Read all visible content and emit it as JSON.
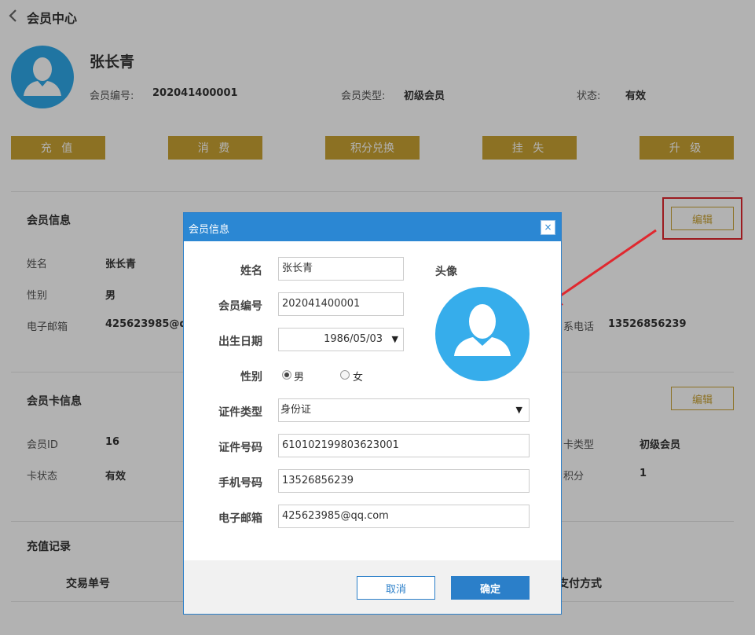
{
  "header": {
    "title": "会员中心"
  },
  "member": {
    "name": "张长青",
    "number_label": "会员编号:",
    "number": "202041400001",
    "type_label": "会员类型:",
    "type": "初级会员",
    "status_label": "状态:",
    "status": "有效"
  },
  "actions": [
    "充 值",
    "消 费",
    "积分兑换",
    "挂 失",
    "升 级"
  ],
  "member_info": {
    "title": "会员信息",
    "edit_label": "编辑",
    "name_label": "姓名",
    "name": "张长青",
    "gender_label": "性别",
    "gender": "男",
    "email_label": "电子邮箱",
    "email_partial": "425623985@qq",
    "phone_label_partial": "系电话",
    "phone": "13526856239"
  },
  "card_info": {
    "title": "会员卡信息",
    "edit_label": "编辑",
    "id_label": "会员ID",
    "id": "16",
    "status_label": "卡状态",
    "status": "有效",
    "type_label_partial": "卡类型",
    "type": "初级会员",
    "points_label_partial": "积分",
    "points": "1"
  },
  "recharge": {
    "title": "充值记录",
    "col_order": "交易单号",
    "col_pay_partial": "支付方式"
  },
  "modal": {
    "title": "会员信息",
    "close": "×",
    "name_label": "姓名",
    "name": "张长青",
    "number_label": "会员编号",
    "number": "202041400001",
    "birth_label": "出生日期",
    "birth": "1986/05/03",
    "gender_label": "性别",
    "gender_male": "男",
    "gender_female": "女",
    "id_type_label": "证件类型",
    "id_type": "身份证",
    "id_no_label": "证件号码",
    "id_no": "610102199803623001",
    "phone_label": "手机号码",
    "phone": "13526856239",
    "email_label": "电子邮箱",
    "email": "425623985@qq.com",
    "avatar_label": "头像",
    "cancel": "取消",
    "confirm": "确定"
  },
  "colors": {
    "gold": "#c9a233",
    "blue": "#2b87d3",
    "avatar": "#36adeb",
    "highlight": "#e0282f"
  }
}
